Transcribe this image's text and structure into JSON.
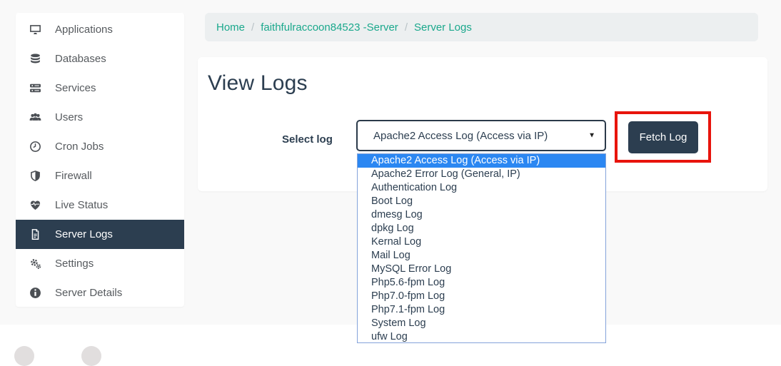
{
  "breadcrumb": {
    "separator": "/",
    "items": [
      {
        "label": "Home"
      },
      {
        "label": "faithfulraccoon84523 -Server"
      },
      {
        "label": "Server Logs"
      }
    ]
  },
  "sidebar": {
    "items": [
      {
        "label": "Applications",
        "icon": "desktop-icon",
        "active": false
      },
      {
        "label": "Databases",
        "icon": "database-icon",
        "active": false
      },
      {
        "label": "Services",
        "icon": "server-icon",
        "active": false
      },
      {
        "label": "Users",
        "icon": "users-icon",
        "active": false
      },
      {
        "label": "Cron Jobs",
        "icon": "clock-icon",
        "active": false
      },
      {
        "label": "Firewall",
        "icon": "shield-icon",
        "active": false
      },
      {
        "label": "Live Status",
        "icon": "heartbeat-icon",
        "active": false
      },
      {
        "label": "Server Logs",
        "icon": "file-icon",
        "active": true
      },
      {
        "label": "Settings",
        "icon": "gears-icon",
        "active": false
      },
      {
        "label": "Server Details",
        "icon": "info-icon",
        "active": false
      }
    ]
  },
  "main": {
    "heading": "View Logs",
    "form": {
      "select_label": "Select log",
      "fetch_button": "Fetch Log",
      "log_select": {
        "selected_value": "Apache2 Access Log (Access via IP)",
        "caret": "▼",
        "highlighted_option": "Apache2 Access Log (Access via IP)",
        "options": [
          "Apache2 Access Log (Access via IP)",
          "Apache2 Error Log (General, IP)",
          "Authentication Log",
          "Boot Log",
          "dmesg Log",
          "dpkg Log",
          "Kernal Log",
          "Mail Log",
          "MySQL Error Log",
          "Php5.6-fpm Log",
          "Php7.0-fpm Log",
          "Php7.1-fpm Log",
          "System Log",
          "ufw Log"
        ]
      }
    }
  },
  "colors": {
    "accent_teal": "#1aa88c",
    "navy": "#2c3e50",
    "option_highlight_blue": "#2b87f2",
    "annotation_red": "#e8140c",
    "dropdown_border_blue": "#84a3da",
    "page_background": "#f9f9f9",
    "breadcrumb_background": "#eceff0"
  }
}
